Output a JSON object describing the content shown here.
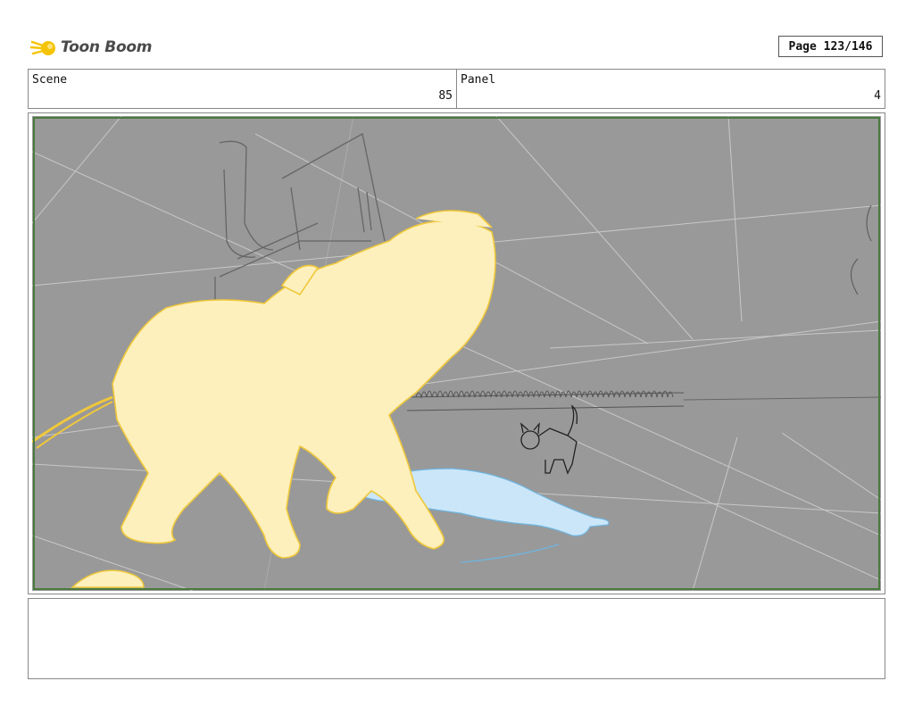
{
  "header": {
    "logo": {
      "text": "Toon Boom",
      "icon": "toon-boom-comet-icon"
    },
    "page_label": "Page 123/146"
  },
  "fields": {
    "scene": {
      "label": "Scene",
      "value": "85"
    },
    "panel": {
      "label": "Panel",
      "value": "4"
    }
  },
  "artwork": {
    "description_icon": "storyboard-sketch",
    "colors": {
      "background": "#999999",
      "frame_border": "#4a7a3e",
      "large_cat_fill": "#fdf0bd",
      "large_cat_stroke": "#f0c83a",
      "blue_figure_fill": "#cbe6f8",
      "blue_figure_stroke": "#6fb5e0",
      "sketch_lines": "#555555",
      "perspective_lines": "#c8c8c8"
    }
  },
  "notes": {
    "text": ""
  }
}
